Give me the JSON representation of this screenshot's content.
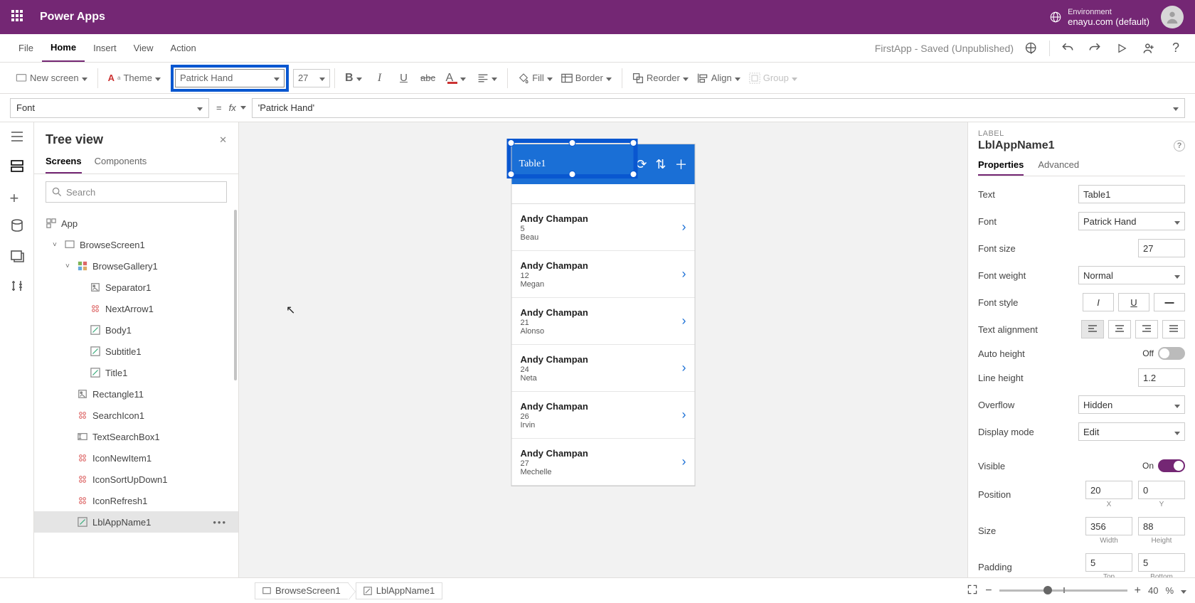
{
  "header": {
    "app_title": "Power Apps",
    "env_label": "Environment",
    "env_name": "enayu.com (default)"
  },
  "menubar": {
    "items": [
      "File",
      "Home",
      "Insert",
      "View",
      "Action"
    ],
    "active": "Home",
    "saved_text": "FirstApp - Saved (Unpublished)"
  },
  "ribbon": {
    "new_screen": "New screen",
    "theme": "Theme",
    "font_name": "Patrick Hand",
    "font_size": "27",
    "fill": "Fill",
    "border": "Border",
    "reorder": "Reorder",
    "align": "Align",
    "group": "Group"
  },
  "formula_bar": {
    "property": "Font",
    "fx": "fx",
    "value": "'Patrick Hand'"
  },
  "tree": {
    "title": "Tree view",
    "tabs": [
      "Screens",
      "Components"
    ],
    "active_tab": "Screens",
    "search_placeholder": "Search",
    "app_label": "App",
    "items": [
      {
        "label": "BrowseScreen1",
        "indent": 1,
        "icon": "screen",
        "chev": "˅"
      },
      {
        "label": "BrowseGallery1",
        "indent": 2,
        "icon": "gallery",
        "chev": "˅"
      },
      {
        "label": "Separator1",
        "indent": 3,
        "icon": "sep"
      },
      {
        "label": "NextArrow1",
        "indent": 3,
        "icon": "icon"
      },
      {
        "label": "Body1",
        "indent": 3,
        "icon": "label"
      },
      {
        "label": "Subtitle1",
        "indent": 3,
        "icon": "label"
      },
      {
        "label": "Title1",
        "indent": 3,
        "icon": "label"
      },
      {
        "label": "Rectangle11",
        "indent": 2,
        "icon": "rect"
      },
      {
        "label": "SearchIcon1",
        "indent": 2,
        "icon": "icon"
      },
      {
        "label": "TextSearchBox1",
        "indent": 2,
        "icon": "input"
      },
      {
        "label": "IconNewItem1",
        "indent": 2,
        "icon": "icon"
      },
      {
        "label": "IconSortUpDown1",
        "indent": 2,
        "icon": "icon"
      },
      {
        "label": "IconRefresh1",
        "indent": 2,
        "icon": "icon"
      },
      {
        "label": "LblAppName1",
        "indent": 2,
        "icon": "label",
        "selected": true
      }
    ]
  },
  "canvas": {
    "title_text": "Table1",
    "rows": [
      {
        "name": "Andy Champan",
        "num": "5",
        "sub": "Beau"
      },
      {
        "name": "Andy Champan",
        "num": "12",
        "sub": "Megan"
      },
      {
        "name": "Andy Champan",
        "num": "21",
        "sub": "Alonso"
      },
      {
        "name": "Andy Champan",
        "num": "24",
        "sub": "Neta"
      },
      {
        "name": "Andy Champan",
        "num": "26",
        "sub": "Irvin"
      },
      {
        "name": "Andy Champan",
        "num": "27",
        "sub": "Mechelle"
      }
    ]
  },
  "props": {
    "type_label": "LABEL",
    "name": "LblAppName1",
    "tabs": [
      "Properties",
      "Advanced"
    ],
    "active_tab": "Properties",
    "rows": {
      "text_label": "Text",
      "text_value": "Table1",
      "font_label": "Font",
      "font_value": "Patrick Hand",
      "fontsize_label": "Font size",
      "fontsize_value": "27",
      "fontweight_label": "Font weight",
      "fontweight_value": "Normal",
      "fontstyle_label": "Font style",
      "align_label": "Text alignment",
      "autoheight_label": "Auto height",
      "autoheight_value": "Off",
      "lineheight_label": "Line height",
      "lineheight_value": "1.2",
      "overflow_label": "Overflow",
      "overflow_value": "Hidden",
      "displaymode_label": "Display mode",
      "displaymode_value": "Edit",
      "visible_label": "Visible",
      "visible_value": "On",
      "position_label": "Position",
      "pos_x": "20",
      "pos_y": "0",
      "pos_x_lbl": "X",
      "pos_y_lbl": "Y",
      "size_label": "Size",
      "size_w": "356",
      "size_h": "88",
      "size_w_lbl": "Width",
      "size_h_lbl": "Height",
      "padding_label": "Padding",
      "pad_t": "5",
      "pad_b": "5",
      "pad_t_lbl": "Top",
      "pad_b_lbl": "Bottom"
    }
  },
  "status": {
    "crumb1": "BrowseScreen1",
    "crumb2": "LblAppName1",
    "zoom": "40",
    "zoom_pct": "%"
  }
}
